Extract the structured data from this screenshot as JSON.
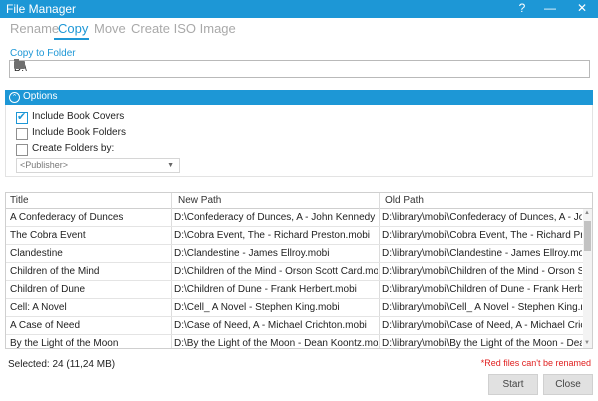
{
  "window": {
    "title": "File Manager",
    "help": "?",
    "minimize": "—",
    "close": "✕"
  },
  "tabs": [
    "Rename",
    "Copy",
    "Move",
    "Create ISO Image"
  ],
  "copy_to": {
    "label": "Copy to Folder",
    "value": "D:\\"
  },
  "options": {
    "header": "Options",
    "collapse_glyph": "⌃",
    "include_book_covers": "Include Book Covers",
    "include_book_folders": "Include Book Folders",
    "create_folders_by": "Create Folders by:",
    "publisher_placeholder": "<Publisher>",
    "checked": {
      "covers": true,
      "folders": false,
      "create": false
    }
  },
  "table": {
    "headers": [
      "Title",
      "New Path",
      "Old Path"
    ],
    "rows": [
      [
        "A Confederacy of Dunces",
        "D:\\Confederacy of Dunces, A - John Kennedy Toole.mobi",
        "D:\\library\\mobi\\Confederacy of Dunces, A - John Kenn..."
      ],
      [
        "The Cobra Event",
        "D:\\Cobra Event, The - Richard Preston.mobi",
        "D:\\library\\mobi\\Cobra Event, The - Richard Preston.mobi"
      ],
      [
        "Clandestine",
        "D:\\Clandestine - James Ellroy.mobi",
        "D:\\library\\mobi\\Clandestine - James Ellroy.mobi"
      ],
      [
        "Children of the Mind",
        "D:\\Children of the Mind - Orson Scott Card.mobi",
        "D:\\library\\mobi\\Children of the Mind - Orson Scott Car..."
      ],
      [
        "Children of Dune",
        "D:\\Children of Dune - Frank Herbert.mobi",
        "D:\\library\\mobi\\Children of Dune - Frank Herbert.mobi"
      ],
      [
        "Cell: A Novel",
        "D:\\Cell_ A Novel - Stephen King.mobi",
        "D:\\library\\mobi\\Cell_ A Novel - Stephen King.mobi"
      ],
      [
        "A Case of Need",
        "D:\\Case of Need, A - Michael Crichton.mobi",
        "D:\\library\\mobi\\Case of Need, A - Michael Crichton.m..."
      ],
      [
        "By the Light of the Moon",
        "D:\\By the Light of the Moon - Dean Koontz.mobi",
        "D:\\library\\mobi\\By the Light of the Moon - Dean Koont..."
      ]
    ]
  },
  "footer": {
    "selected": "Selected:  24 (11,24 MB)",
    "red_note": "*Red files can't be renamed",
    "start": "Start",
    "close": "Close"
  },
  "colors": {
    "accent": "#1d97d6",
    "warning": "#e02020"
  },
  "icons": {
    "browse": "folder-icon",
    "collapse": "chevron-up-icon",
    "check": "check-icon"
  }
}
